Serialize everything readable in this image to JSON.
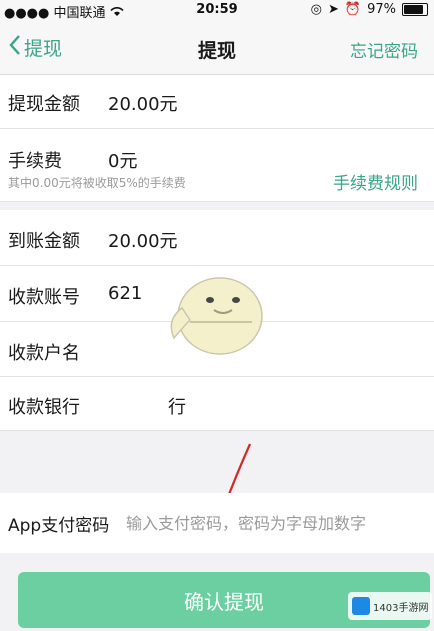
{
  "status": {
    "carrier": "中国联通",
    "time": "20:59",
    "battery": "97%",
    "battery_level": 0.97
  },
  "nav": {
    "back_label": "提现",
    "title": "提现",
    "right_label": "忘记密码"
  },
  "rows": {
    "amount": {
      "label": "提现金额",
      "value": "20.00元"
    },
    "fee": {
      "label": "手续费",
      "value": "0元",
      "note": "其中0.00元将被收取5%的手续费",
      "rule_link": "手续费规则"
    },
    "received": {
      "label": "到账金额",
      "value": "20.00元"
    },
    "account": {
      "label": "收款账号",
      "value": "621"
    },
    "holder": {
      "label": "收款户名",
      "value": ""
    },
    "bank": {
      "label": "收款银行",
      "value": "行"
    }
  },
  "pay_password": {
    "label": "App支付密码",
    "placeholder": "输入支付密码，密码为字母加数字"
  },
  "confirm_button": "确认提现",
  "watermark": {
    "text": "1403手游网"
  },
  "colors": {
    "accent": "#3aa58a",
    "button": "#6ccfa2",
    "annotation_arrow": "#d22a2a"
  }
}
